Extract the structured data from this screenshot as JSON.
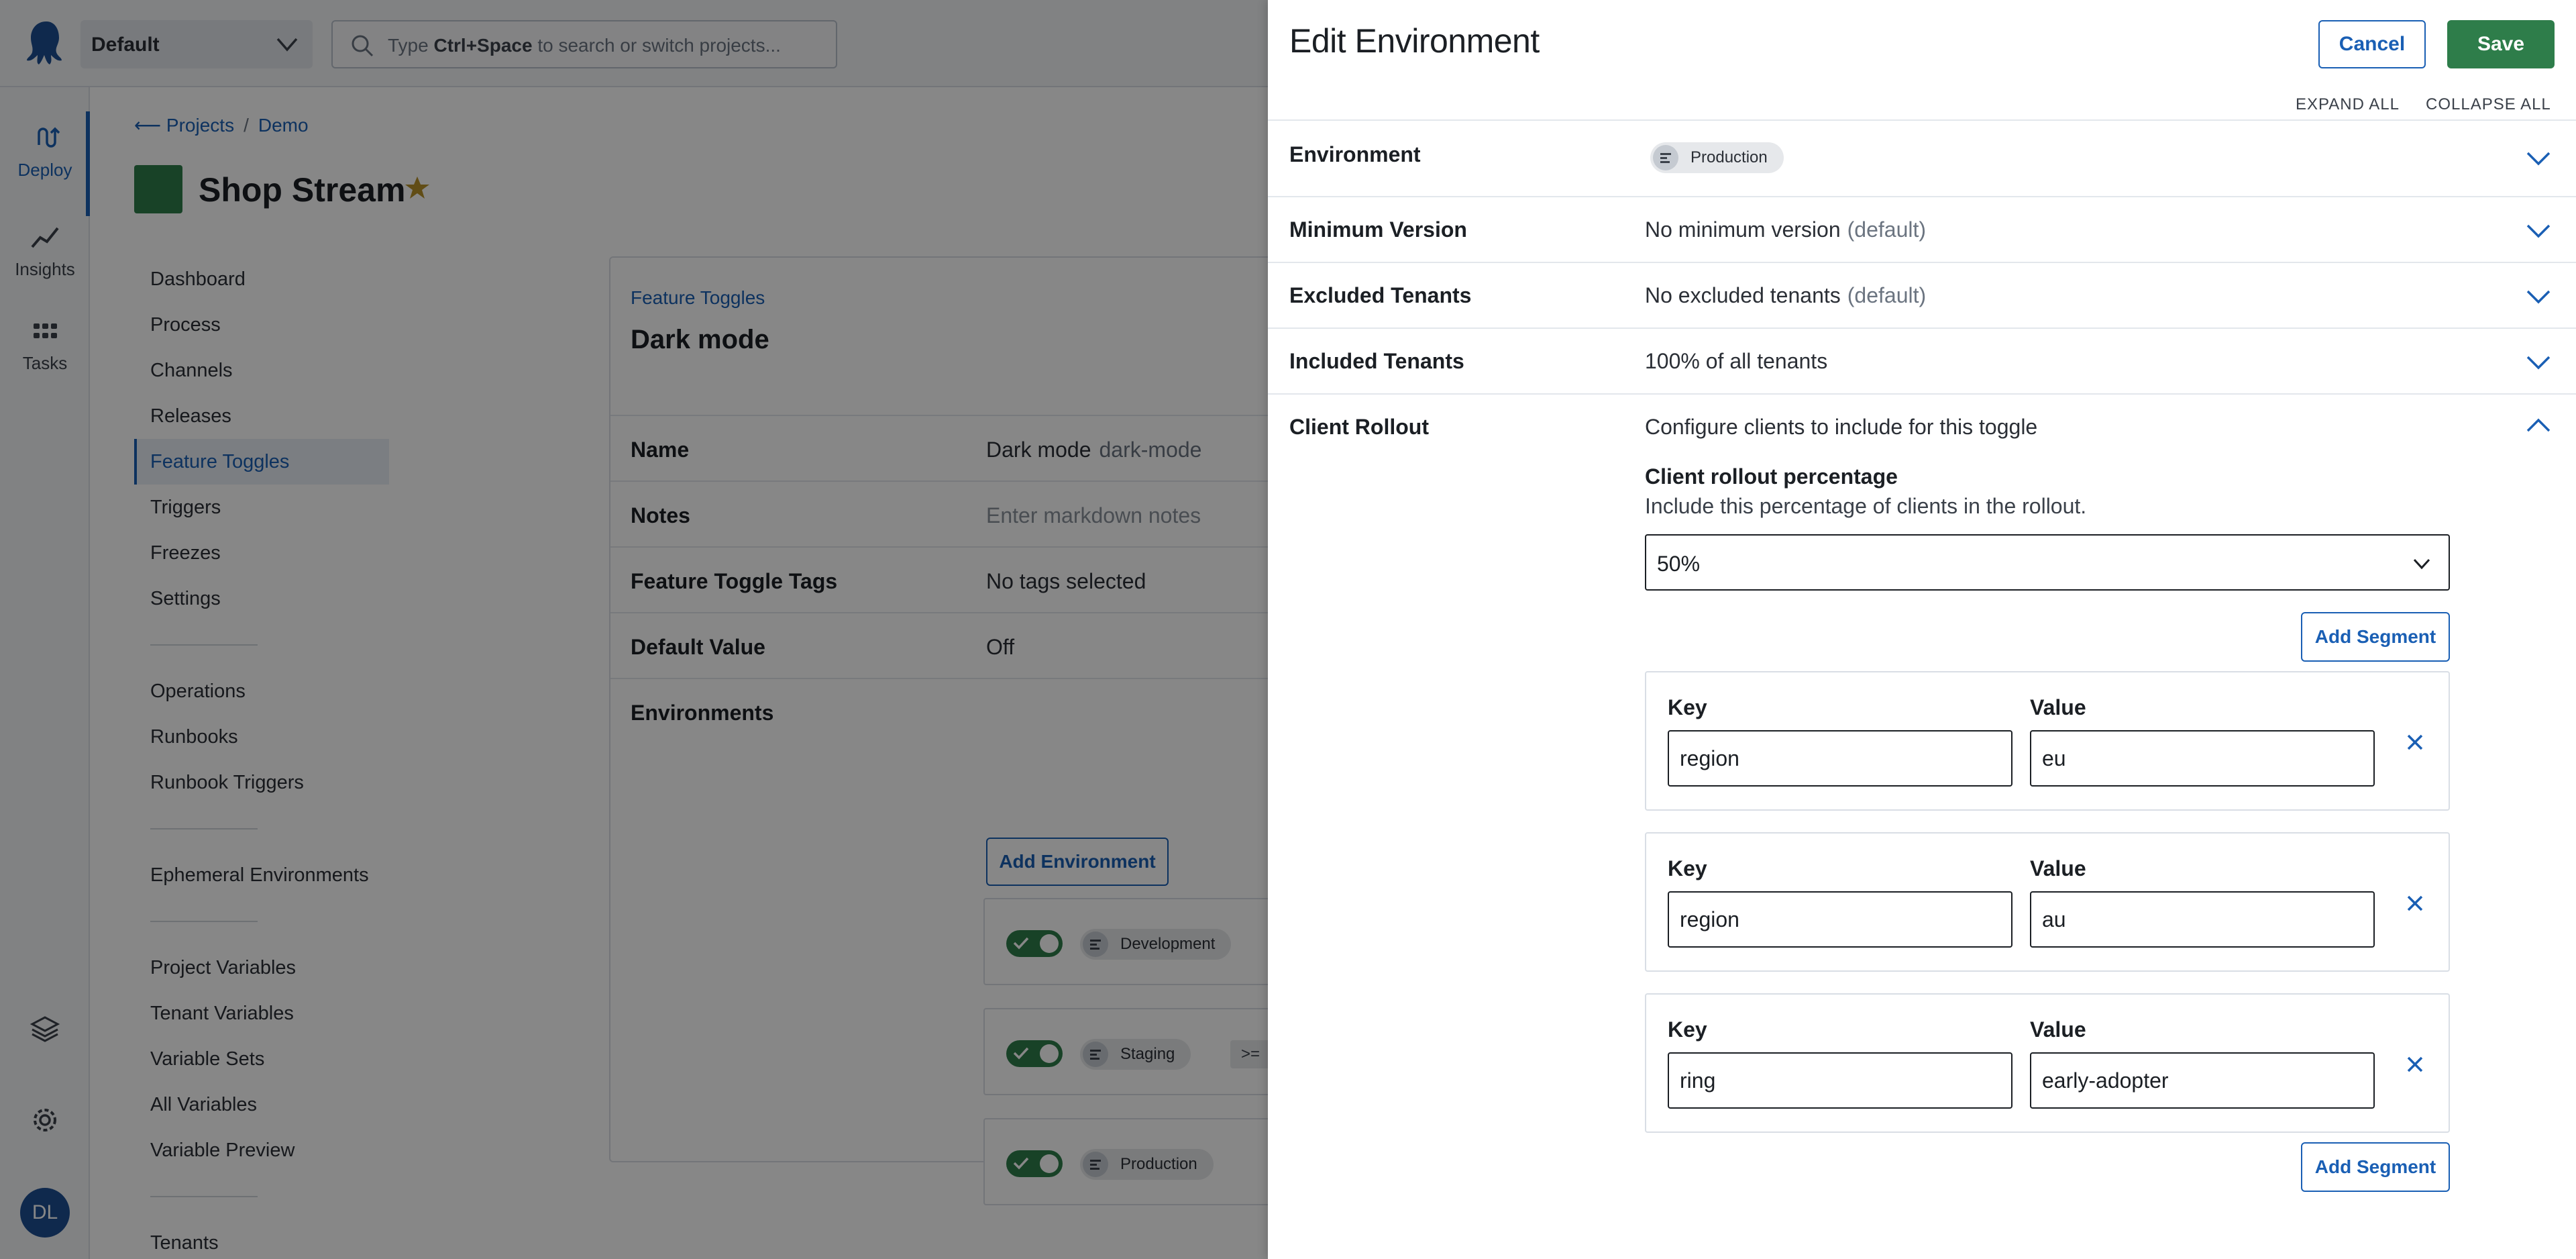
{
  "topbar": {
    "space": "Default",
    "search_placeholder_pre": "Type",
    "search_placeholder_shortcut": "Ctrl+Space",
    "search_placeholder_post": "to search or switch projects..."
  },
  "rail": {
    "items": [
      {
        "label": "Deploy",
        "icon": "deploy-icon"
      },
      {
        "label": "Insights",
        "icon": "insights-icon"
      },
      {
        "label": "Tasks",
        "icon": "tasks-icon"
      }
    ],
    "avatar_initials": "DL"
  },
  "breadcrumb": {
    "projects": "Projects",
    "separator": "/",
    "group": "Demo"
  },
  "project": {
    "name": "Shop Stream"
  },
  "nav": {
    "group1": [
      "Dashboard",
      "Process",
      "Channels",
      "Releases",
      "Feature Toggles",
      "Triggers",
      "Freezes",
      "Settings"
    ],
    "group2": [
      "Operations",
      "Runbooks",
      "Runbook Triggers"
    ],
    "group3": [
      "Ephemeral Environments"
    ],
    "group4": [
      "Project Variables",
      "Tenant Variables",
      "Variable Sets",
      "All Variables",
      "Variable Preview"
    ],
    "group5": [
      "Tenants"
    ],
    "active": "Feature Toggles"
  },
  "toggle_card": {
    "crumb": "Feature Toggles",
    "title": "Dark mode",
    "fields": {
      "name_label": "Name",
      "name_value": "Dark mode",
      "name_slug": "dark-mode",
      "notes_label": "Notes",
      "notes_placeholder": "Enter markdown notes",
      "tags_label": "Feature Toggle Tags",
      "tags_value": "No tags selected",
      "default_label": "Default Value",
      "default_value": "Off",
      "envs_label": "Environments"
    },
    "add_environment": "Add Environment",
    "environments": [
      {
        "name": "Development"
      },
      {
        "name": "Staging",
        "version_prefix": ">="
      },
      {
        "name": "Production"
      }
    ]
  },
  "drawer": {
    "title": "Edit Environment",
    "cancel": "Cancel",
    "save": "Save",
    "expand_all": "EXPAND ALL",
    "collapse_all": "COLLAPSE ALL",
    "rows": {
      "environment_label": "Environment",
      "environment_value": "Production",
      "min_version_label": "Minimum Version",
      "min_version_value": "No minimum version",
      "min_version_default": "(default)",
      "excluded_label": "Excluded Tenants",
      "excluded_value": "No excluded tenants",
      "excluded_default": "(default)",
      "included_label": "Included Tenants",
      "included_value": "100% of all tenants",
      "rollout_label": "Client Rollout",
      "rollout_value": "Configure clients to include for this toggle"
    },
    "rollout": {
      "title": "Client rollout percentage",
      "description": "Include this percentage of clients in the rollout.",
      "percentage": "50%",
      "add_segment": "Add Segment",
      "key_label": "Key",
      "value_label": "Value",
      "segments": [
        {
          "key": "region",
          "value": "eu"
        },
        {
          "key": "region",
          "value": "au"
        },
        {
          "key": "ring",
          "value": "early-adopter"
        }
      ]
    }
  },
  "colors": {
    "accent": "#1a5fb4",
    "save_green": "#2e7d4a",
    "toggle_on": "#2e7d4a",
    "star": "#b7922a"
  }
}
